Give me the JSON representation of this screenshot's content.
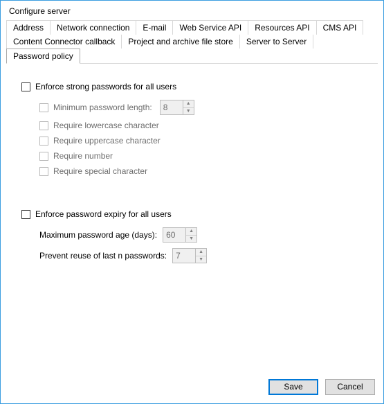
{
  "title": "Configure server",
  "tabs_row1": [
    "Address",
    "Network connection",
    "E-mail",
    "Web Service API",
    "Resources API",
    "CMS API"
  ],
  "tabs_row2": [
    "Content Connector callback",
    "Project and archive file store",
    "Server to Server",
    "Password policy"
  ],
  "active_tab": "Password policy",
  "group1": {
    "parent": "Enforce strong passwords for all users",
    "min_len_label": "Minimum password length:",
    "min_len_value": "8",
    "req_lower": "Require lowercase character",
    "req_upper": "Require uppercase character",
    "req_number": "Require number",
    "req_special": "Require special character"
  },
  "group2": {
    "parent": "Enforce password expiry for all users",
    "max_age_label": "Maximum password age (days):",
    "max_age_value": "60",
    "reuse_label": "Prevent reuse of last n passwords:",
    "reuse_value": "7"
  },
  "buttons": {
    "save": "Save",
    "cancel": "Cancel"
  }
}
